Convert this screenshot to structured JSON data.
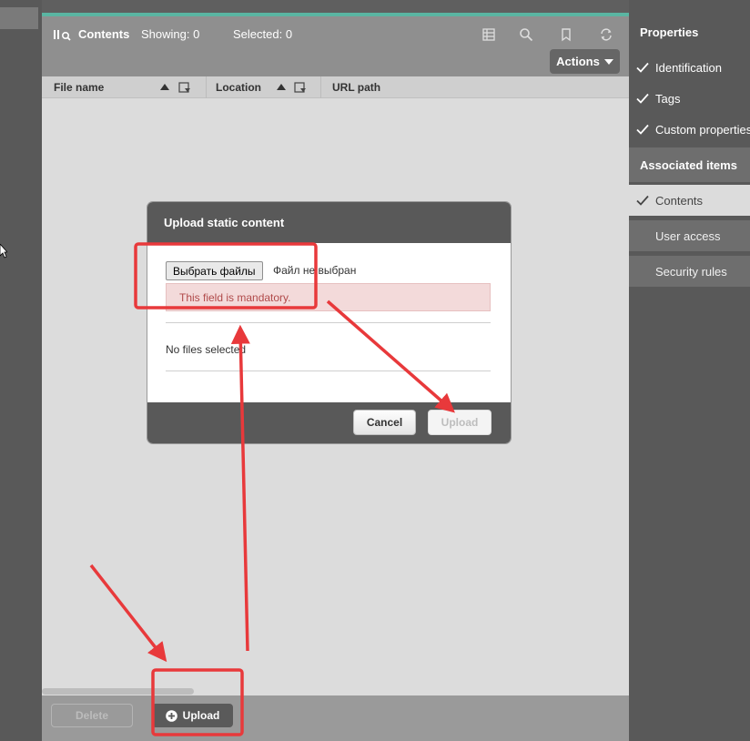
{
  "header": {
    "title": "Contents",
    "showing": "Showing: 0",
    "selected": "Selected: 0",
    "actions_label": "Actions"
  },
  "table": {
    "columns": [
      "File name",
      "Location",
      "URL path"
    ]
  },
  "footer": {
    "delete_label": "Delete",
    "upload_label": "Upload"
  },
  "sidebar": {
    "properties_header": "Properties",
    "properties_items": [
      "Identification",
      "Tags",
      "Custom properties"
    ],
    "associated_header": "Associated items",
    "associated_items": [
      "Contents",
      "User access",
      "Security rules"
    ]
  },
  "dialog": {
    "title": "Upload static content",
    "choose_button": "Выбрать файлы",
    "no_file_text": "Файл не выбран",
    "error_text": "This field is mandatory.",
    "no_files_selected": "No files selected",
    "cancel_label": "Cancel",
    "upload_label": "Upload"
  },
  "colors": {
    "accent_teal": "#5ab5a2",
    "annotation_red": "#e8393b",
    "error_text": "#b04a4a",
    "error_bg": "#f3dada"
  }
}
